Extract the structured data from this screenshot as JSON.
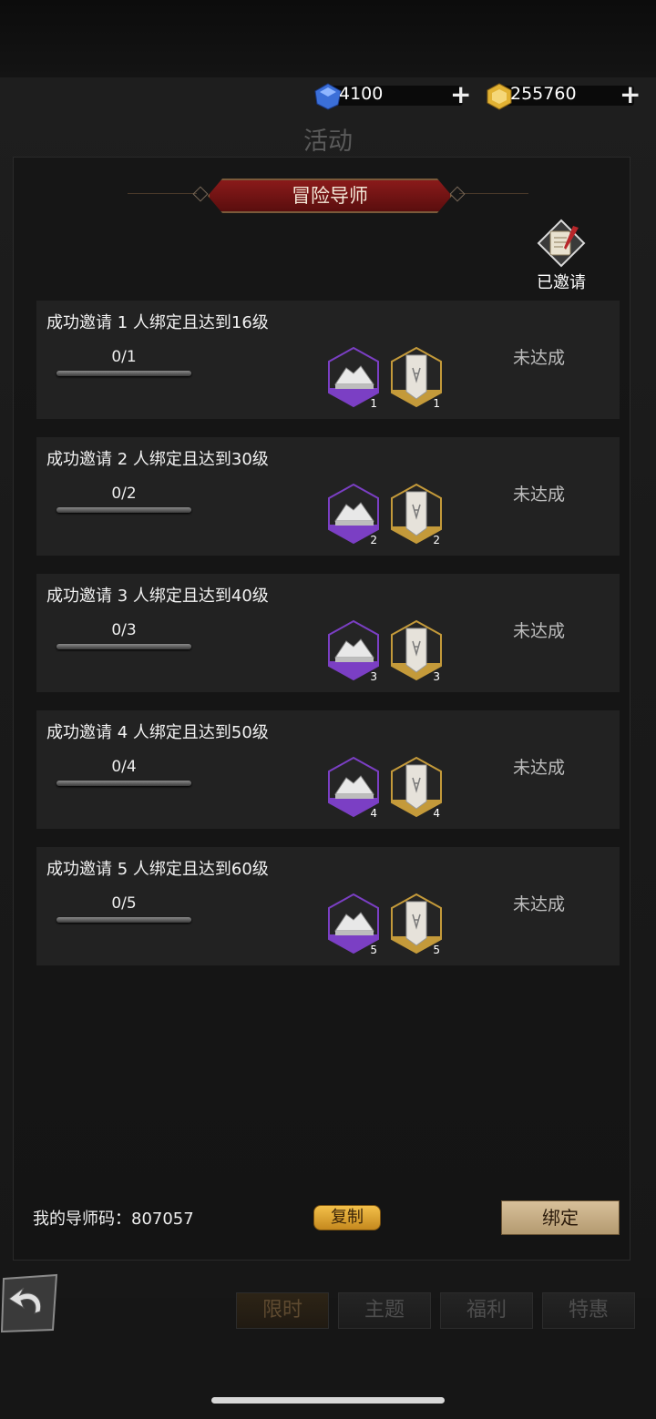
{
  "currency": [
    {
      "icon": "blue-diamond-icon",
      "value": "4100"
    },
    {
      "icon": "gold-coin-icon",
      "value": "255760"
    }
  ],
  "page_title": "活动",
  "banner": "冒险导师",
  "invited_label": "已邀请",
  "tasks": [
    {
      "title": "成功邀请 1 人绑定且达到16级",
      "progress": "0/1",
      "rewards": [
        "1",
        "1"
      ],
      "status": "未达成"
    },
    {
      "title": "成功邀请 2 人绑定且达到30级",
      "progress": "0/2",
      "rewards": [
        "2",
        "2"
      ],
      "status": "未达成"
    },
    {
      "title": "成功邀请 3 人绑定且达到40级",
      "progress": "0/3",
      "rewards": [
        "3",
        "3"
      ],
      "status": "未达成"
    },
    {
      "title": "成功邀请 4 人绑定且达到50级",
      "progress": "0/4",
      "rewards": [
        "4",
        "4"
      ],
      "status": "未达成"
    },
    {
      "title": "成功邀请 5 人绑定且达到60级",
      "progress": "0/5",
      "rewards": [
        "5",
        "5"
      ],
      "status": "未达成"
    }
  ],
  "footer": {
    "code_label": "我的导师码：807057",
    "copy": "复制",
    "bind": "绑定"
  },
  "tabs": [
    "限时",
    "主题",
    "福利",
    "特惠"
  ],
  "active_tab": "限时"
}
